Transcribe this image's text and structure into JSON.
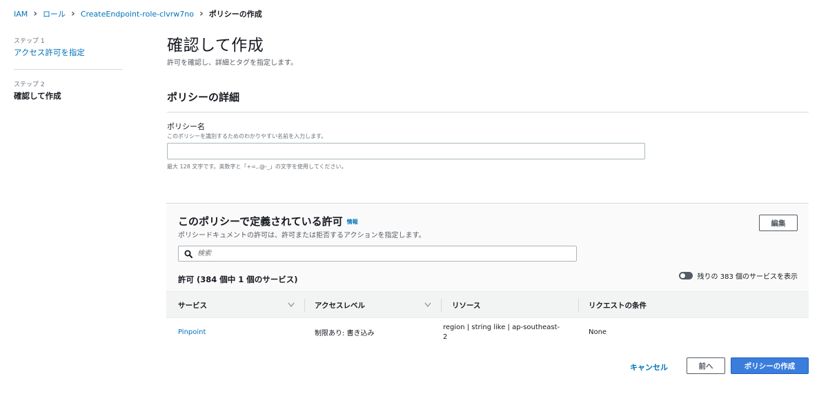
{
  "breadcrumb": {
    "items": [
      "IAM",
      "ロール",
      "CreateEndpoint-role-clvrw7no"
    ],
    "current": "ポリシーの作成"
  },
  "steps": [
    {
      "num": "ステップ 1",
      "label": "アクセス許可を指定"
    },
    {
      "num": "ステップ 2",
      "label": "確認して作成"
    }
  ],
  "page": {
    "title": "確認して作成",
    "description": "許可を確認し、詳細とタグを指定します。"
  },
  "policy_details": {
    "title": "ポリシーの詳細",
    "name_label": "ポリシー名",
    "name_sub": "このポリシーを識別するためのわかりやすい名前を入力します。",
    "name_value": "",
    "name_hint": "最大 128 文字です。英数字と「+=,.@-_」の文字を使用してください。"
  },
  "permissions": {
    "title": "このポリシーで定義されている許可",
    "info_link": "情報",
    "description": "ポリシードキュメントの許可は、許可または拒否するアクションを指定します。",
    "edit_label": "編集",
    "search_placeholder": "検索",
    "allow_count": "許可 (384 個中 1 個のサービス)",
    "toggle_label": "残りの 383 個のサービスを表示",
    "columns": [
      "サービス",
      "アクセスレベル",
      "リソース",
      "リクエストの条件"
    ],
    "rows": [
      {
        "service": "Pinpoint",
        "access_level": "制限あり: 書き込み",
        "resource_line1": "region | string like | ap-southeast-",
        "resource_line2": "2",
        "condition": "None"
      }
    ]
  },
  "footer": {
    "cancel_label": "キャンセル",
    "prev_label": "前へ",
    "create_label": "ポリシーの作成"
  },
  "colors": {
    "link": "#0073bb",
    "primary_button": "#3b7ddd",
    "text": "#16191f",
    "muted": "#545b64"
  },
  "icons": [
    "chevron-right-icon",
    "search-icon",
    "sort-down-icon",
    "toggle-switch-icon"
  ]
}
